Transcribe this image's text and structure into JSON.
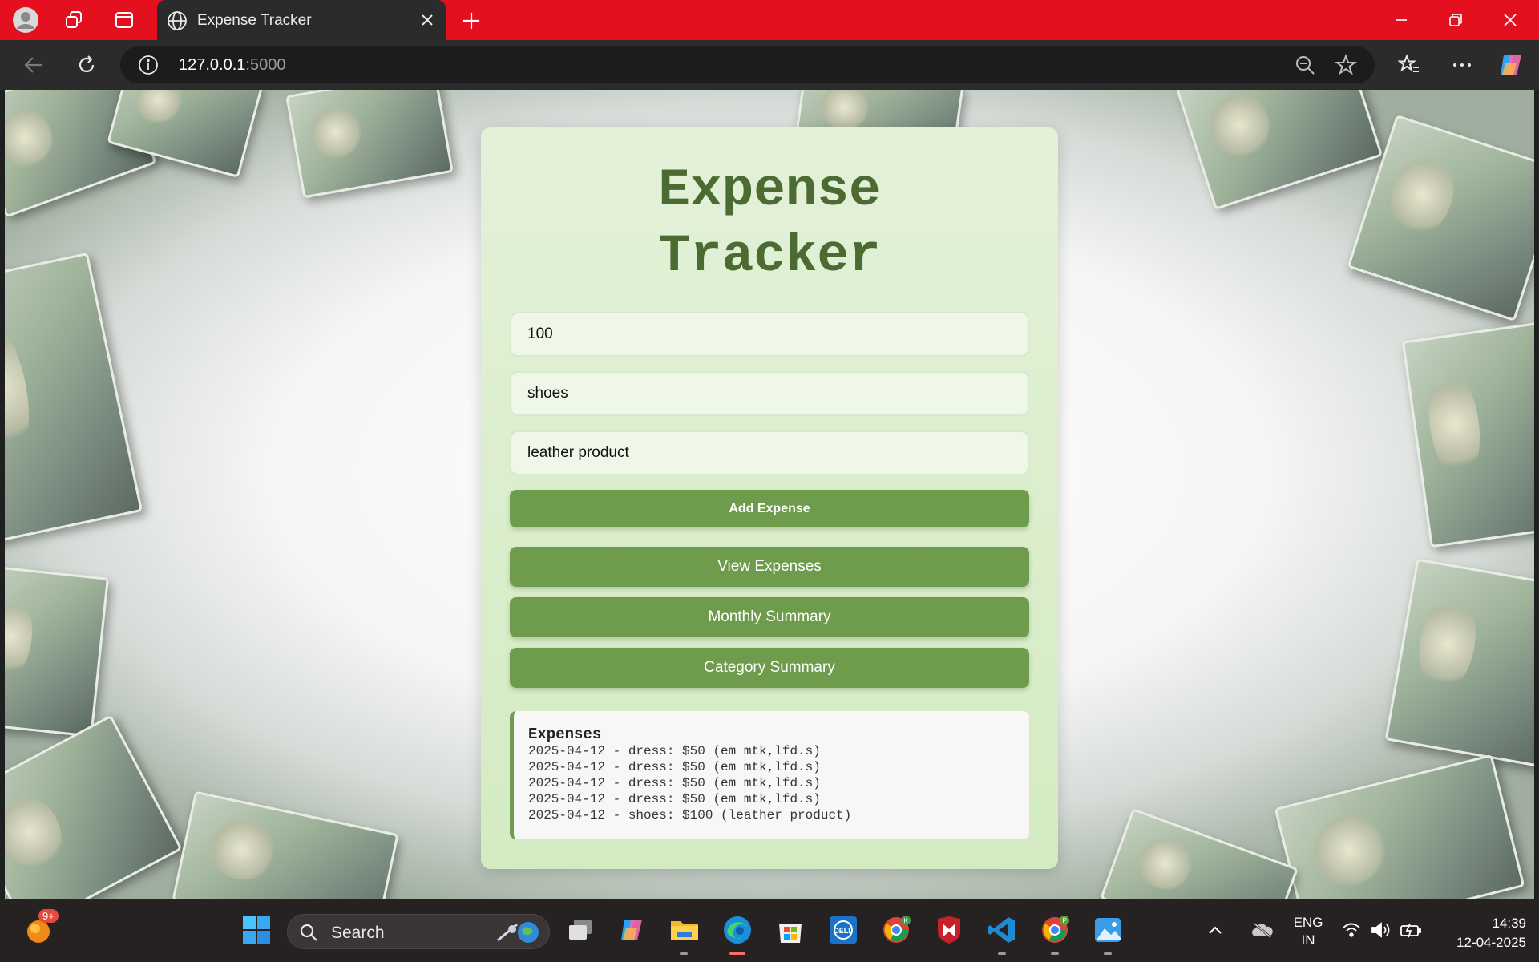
{
  "browser": {
    "tab_title": "Expense Tracker",
    "url_host": "127.0.0.1",
    "url_port": ":5000",
    "accent_color": "#e4101f"
  },
  "app": {
    "title_line1": "Expense",
    "title_line2": "Tracker",
    "amount_value": "100",
    "category_value": "shoes",
    "description_value": "leather product",
    "add_button": "Add Expense",
    "view_button": "View Expenses",
    "monthly_button": "Monthly Summary",
    "category_button": "Category Summary",
    "output": {
      "title": "Expenses",
      "rows": [
        "2025-04-12 - dress: $50 (em mtk,lfd.s)",
        "2025-04-12 - dress: $50 (em mtk,lfd.s)",
        "2025-04-12 - dress: $50 (em mtk,lfd.s)",
        "2025-04-12 - dress: $50 (em mtk,lfd.s)",
        "2025-04-12 - shoes: $100 (leather product)"
      ]
    },
    "primary_color": "#6f9c4c",
    "heading_color": "#4b6b33"
  },
  "taskbar": {
    "widget_badge": "9+",
    "search_label": "Search",
    "lang_line1": "ENG",
    "lang_line2": "IN",
    "time": "14:39",
    "date": "12-04-2025",
    "chrome_profile_1": "K",
    "chrome_profile_2": "P"
  }
}
